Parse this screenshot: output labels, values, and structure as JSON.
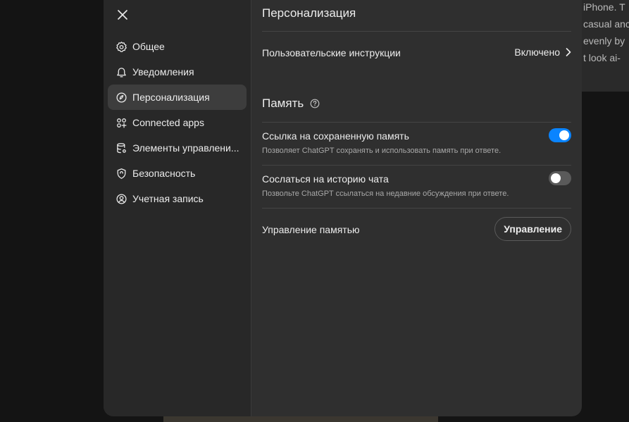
{
  "background_text": [
    "iPhone. T",
    "casual anc",
    "evenly by",
    "t look ai-"
  ],
  "sidebar": {
    "close_icon": "close-icon",
    "items": [
      {
        "label": "Общее",
        "icon": "gear-icon",
        "active": false
      },
      {
        "label": "Уведомления",
        "icon": "bell-icon",
        "active": false
      },
      {
        "label": "Персонализация",
        "icon": "personalization-icon",
        "active": true
      },
      {
        "label": "Connected apps",
        "icon": "apps-grid-icon",
        "active": false
      },
      {
        "label": "Элементы управлени...",
        "icon": "database-icon",
        "active": false
      },
      {
        "label": "Безопасность",
        "icon": "shield-icon",
        "active": false
      },
      {
        "label": "Учетная запись",
        "icon": "user-circle-icon",
        "active": false
      }
    ]
  },
  "main": {
    "title": "Персонализация",
    "custom_instructions": {
      "label": "Пользовательские инструкции",
      "value": "Включено"
    },
    "memory": {
      "title": "Память",
      "saved_memory": {
        "label": "Ссылка на сохраненную память",
        "description": "Позволяет ChatGPT сохранять и использовать память при ответе.",
        "enabled": true
      },
      "chat_history": {
        "label": "Сослаться на историю чата",
        "description": "Позвольте ChatGPT ссылаться на недавние обсуждения при ответе.",
        "enabled": false
      },
      "manage": {
        "label": "Управление памятью",
        "button_label": "Управление"
      }
    }
  },
  "colors": {
    "toggle_on": "#0a84ff",
    "toggle_off": "#5a5a5a",
    "panel": "#2f2f2f",
    "sidebar": "#282828"
  }
}
